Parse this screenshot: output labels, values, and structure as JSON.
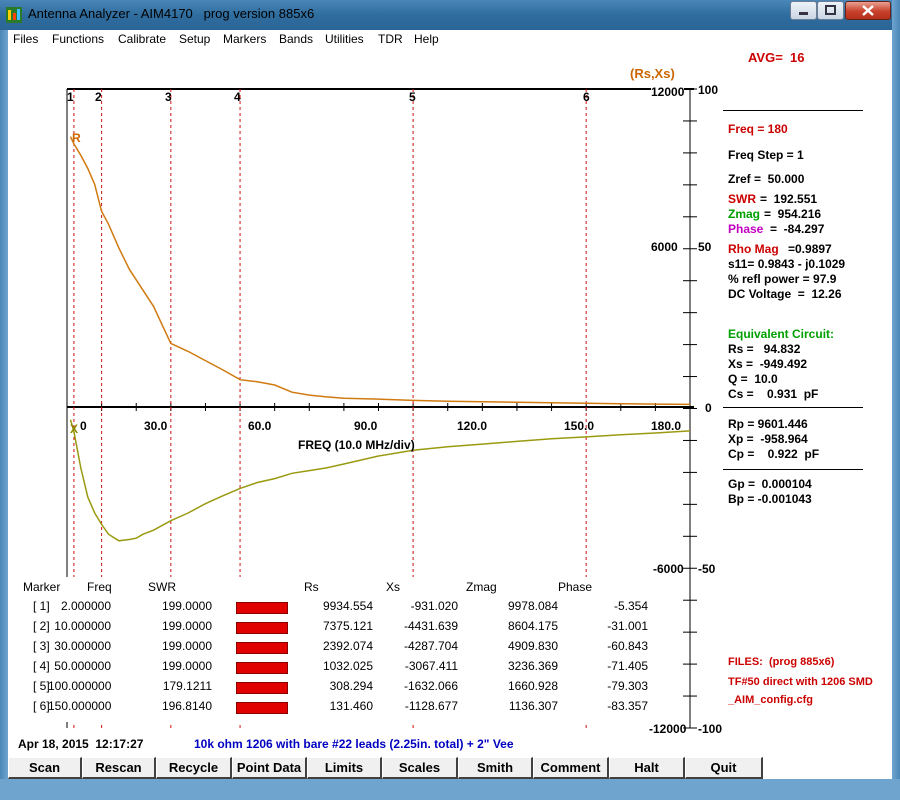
{
  "window": {
    "title": "Antenna Analyzer - AIM4170   prog version 885x6",
    "menu": [
      "Files",
      "Functions",
      "Calibrate",
      "Setup",
      "Markers",
      "Bands",
      "Utilities",
      "TDR",
      "Help"
    ]
  },
  "plot": {
    "avg_label": "AVG=  16",
    "series_label": "(Rs,Xs)",
    "r_label": "R",
    "x_label": "X",
    "xlabel": "FREQ (10.0 MHz/div)",
    "xticks": [
      "0",
      "30.0",
      "60.0",
      "90.0",
      "120.0",
      "150.0",
      "180.0"
    ],
    "rs_ticks": [
      "12000",
      "6000",
      "0",
      "-6000",
      "-12000"
    ],
    "pct_ticks": [
      "100",
      "50",
      "0",
      "-50",
      "-100"
    ],
    "markers": [
      "1",
      "2",
      "3",
      "4",
      "5",
      "6"
    ]
  },
  "chart_data": {
    "type": "line",
    "xlabel": "FREQ (10.0 MHz/div)",
    "xlim": [
      0,
      180
    ],
    "ylim": [
      -12000,
      12000
    ],
    "markers_freq": [
      2,
      10,
      30,
      50,
      100,
      150
    ],
    "series": [
      {
        "name": "R",
        "x": [
          1,
          2,
          4,
          6,
          8,
          10,
          12,
          15,
          18,
          20,
          25,
          30,
          35,
          40,
          45,
          50,
          55,
          60,
          65,
          70,
          75,
          80,
          90,
          100,
          110,
          120,
          130,
          140,
          150,
          160,
          170,
          180
        ],
        "values": [
          10200,
          9930,
          9500,
          9000,
          8400,
          7380,
          6900,
          6000,
          5200,
          4800,
          3800,
          2400,
          2100,
          1750,
          1400,
          1030,
          950,
          830,
          560,
          450,
          380,
          330,
          300,
          250,
          220,
          200,
          180,
          160,
          140,
          120,
          110,
          100
        ]
      },
      {
        "name": "X",
        "x": [
          1,
          2,
          4,
          6,
          8,
          10,
          12,
          15,
          18,
          20,
          22,
          25,
          30,
          35,
          40,
          45,
          50,
          55,
          60,
          65,
          70,
          75,
          80,
          90,
          100,
          110,
          120,
          130,
          140,
          150,
          160,
          170,
          180
        ],
        "values": [
          -480,
          -930,
          -2300,
          -3400,
          -4000,
          -4430,
          -4800,
          -5050,
          -5000,
          -4950,
          -4800,
          -4650,
          -4290,
          -4000,
          -3650,
          -3350,
          -3070,
          -2850,
          -2700,
          -2500,
          -2400,
          -2300,
          -2150,
          -1850,
          -1630,
          -1500,
          -1400,
          -1300,
          -1200,
          -1130,
          -1050,
          -980,
          -900
        ]
      }
    ]
  },
  "side": {
    "freq": "Freq = 180",
    "freq_step": "Freq Step = 1",
    "zref": "Zref =  50.000",
    "swr_label": "SWR",
    "swr_val": "=  192.551",
    "zmag_label": "Zmag",
    "zmag_val": "=  954.216",
    "phase_label": "Phase",
    "phase_val": "=  -84.297",
    "rho_label": "Rho Mag",
    "rho_val": "=0.9897",
    "s11": "s11= 0.9843 - j0.1029",
    "refl": "% refl power = 97.9",
    "dcv": "DC Voltage  =  12.26",
    "equiv": "Equivalent Circuit:",
    "rs": "Rs =   94.832",
    "xs": "Xs =  -949.492",
    "q": "Q =  10.0",
    "cs": "Cs =    0.931  pF",
    "rp": "Rp = 9601.446",
    "xp": "Xp =  -958.964",
    "cp": "Cp =    0.922  pF",
    "gp": "Gp =  0.000104",
    "bp": "Bp = -0.001043",
    "files1": "FILES:  (prog 885x6)",
    "files2": "TF#50 direct with 1206 SMD",
    "files3": "_AIM_config.cfg",
    "colors": {
      "red": "#cc0000",
      "green": "#00a000",
      "magenta": "#c000c0",
      "orange": "#cc6600",
      "olive": "#8b8b00"
    }
  },
  "table": {
    "headers": [
      "Marker",
      "Freq",
      "SWR",
      "Rs",
      "Xs",
      "Zmag",
      "Phase"
    ],
    "rows": [
      {
        "m": "[ 1]",
        "freq": "2.000000",
        "swr": "199.0000",
        "rs": "9934.554",
        "xs": "-931.020",
        "zmag": "9978.084",
        "phase": "-5.354"
      },
      {
        "m": "[ 2]",
        "freq": "10.000000",
        "swr": "199.0000",
        "rs": "7375.121",
        "xs": "-4431.639",
        "zmag": "8604.175",
        "phase": "-31.001"
      },
      {
        "m": "[ 3]",
        "freq": "30.000000",
        "swr": "199.0000",
        "rs": "2392.074",
        "xs": "-4287.704",
        "zmag": "4909.830",
        "phase": "-60.843"
      },
      {
        "m": "[ 4]",
        "freq": "50.000000",
        "swr": "199.0000",
        "rs": "1032.025",
        "xs": "-3067.411",
        "zmag": "3236.369",
        "phase": "-71.405"
      },
      {
        "m": "[ 5]",
        "freq": "100.000000",
        "swr": "179.1211",
        "rs": "308.294",
        "xs": "-1632.066",
        "zmag": "1660.928",
        "phase": "-79.303"
      },
      {
        "m": "[ 6]",
        "freq": "150.000000",
        "swr": "196.8140",
        "rs": "131.460",
        "xs": "-1128.677",
        "zmag": "1136.307",
        "phase": "-83.357"
      }
    ]
  },
  "status": {
    "datetime": "Apr 18, 2015  12:17:27",
    "note": "10k ohm 1206 with bare #22 leads (2.25in. total) + 2\" Vee"
  },
  "buttons": [
    "Scan",
    "Rescan",
    "Recycle",
    "Point Data",
    "Limits",
    "Scales",
    "Smith",
    "Comment",
    "Halt",
    "Quit"
  ]
}
